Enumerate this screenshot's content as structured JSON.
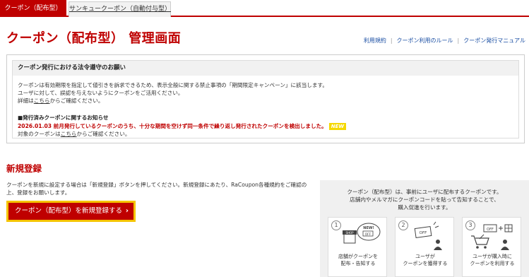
{
  "tabs": [
    {
      "label": "クーポン（配布型）",
      "active": true
    },
    {
      "label": "サンキュークーポン（自動付与型）",
      "active": false
    }
  ],
  "page_title": "クーポン（配布型） 管理画面",
  "top_links": [
    "利用規約",
    "クーポン利用のルール",
    "クーポン発行マニュアル"
  ],
  "notice": {
    "heading": "クーポン発行における法令遵守のお願い",
    "line1": "クーポンは有効期限を指定して値引きを訴求できるため、表示全般に関する禁止事項の「期間限定キャンペーン」に該当します。",
    "line2": "ユーザに対して、誤認を与えないようにクーポンをご活用ください。",
    "line3_pre": "詳細は",
    "line3_link": "こちら",
    "line3_post": "からご確認ください。",
    "sub_title": "■発行済みクーポンに関するお知らせ",
    "alert": "2026.01.03 前月発行しているクーポンのうち、十分な期間を空けず同一条件で繰り返し発行されたクーポンを検出しました。",
    "new_badge": "NEW",
    "body_pre": "対象のクーポンは",
    "body_link": "こちら",
    "body_post": "からご確認ください。"
  },
  "register": {
    "title": "新規登録",
    "desc": "クーポンを新規に設定する場合は「新規登録」ボタンを押してください。新規登録にあたり、RaCoupon各種規約をご確認の上、登録をお願いします。",
    "button_label": "クーポン（配布型）を新規登録する",
    "button_chevron": "›"
  },
  "info": {
    "line1": "クーポン（配布型）は、事前にユーザに配布するクーポンです。",
    "line2": "店舗内やメルマガにクーポンコードを貼って告知することで、",
    "line3": "購入促進を行います。",
    "steps": [
      {
        "num": "1",
        "label1": "店舗がクーポンを",
        "label2": "配布・告知する",
        "icon_shop": "SHOP",
        "icon_new": "NEW!",
        "icon_off": "OFF"
      },
      {
        "num": "2",
        "label1": "ユーザが",
        "label2": "クーポンを獲得する",
        "icon_off": "OFF"
      },
      {
        "num": "3",
        "label1": "ユーザが購入時に",
        "label2": "クーポンを利用する",
        "icon_off": "OFF"
      }
    ]
  },
  "colors": {
    "brand_red": "#bf0000",
    "button_outline": "#f5c400",
    "link_blue": "#1a4ea3"
  }
}
